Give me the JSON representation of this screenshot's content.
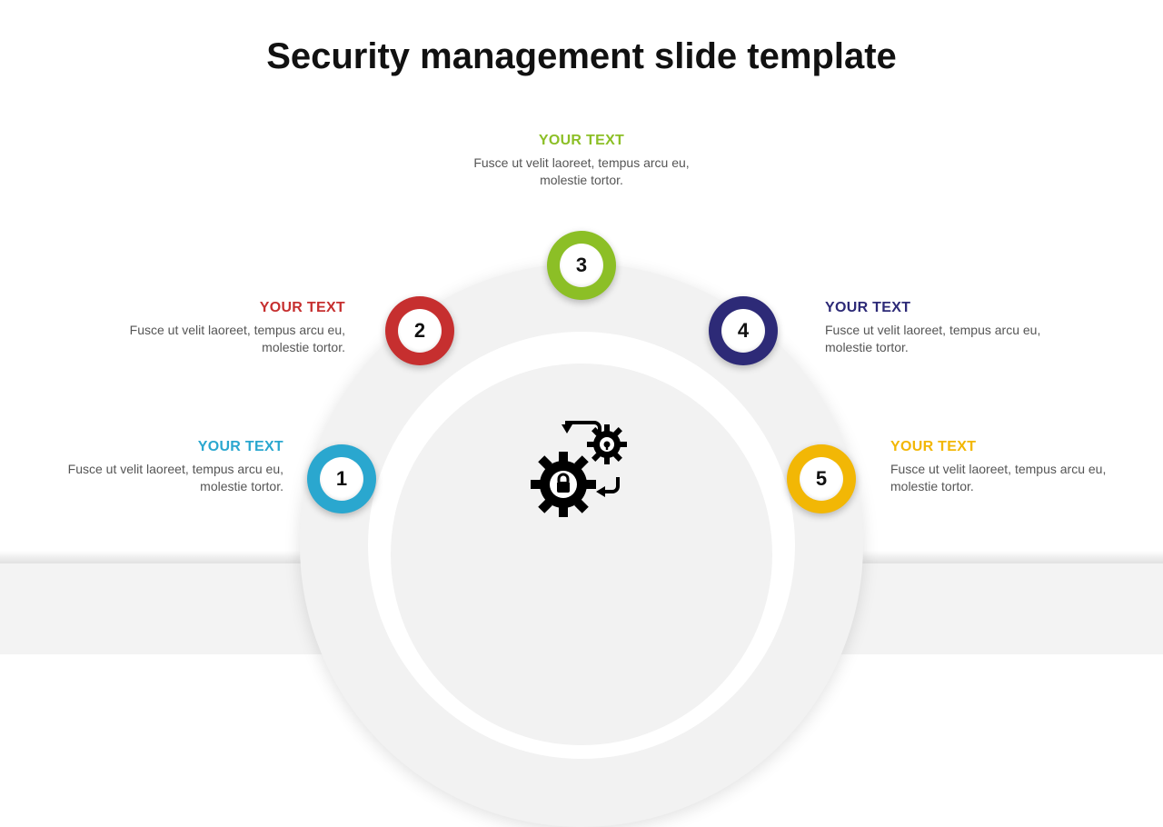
{
  "title": "Security management slide template",
  "nodes": [
    {
      "num": "1",
      "color": "#2aa7cf",
      "label": "YOUR TEXT",
      "body": "Fusce ut velit laoreet, tempus arcu eu, molestie tortor."
    },
    {
      "num": "2",
      "color": "#c62f2f",
      "label": "YOUR TEXT",
      "body": "Fusce ut velit laoreet, tempus arcu eu, molestie tortor."
    },
    {
      "num": "3",
      "color": "#8cbf26",
      "label": "YOUR TEXT",
      "body": "Fusce ut velit laoreet, tempus arcu eu, molestie tortor."
    },
    {
      "num": "4",
      "color": "#2d2a77",
      "label": "YOUR TEXT",
      "body": "Fusce ut velit laoreet, tempus arcu eu, molestie tortor."
    },
    {
      "num": "5",
      "color": "#f2b705",
      "label": "YOUR TEXT",
      "body": "Fusce ut velit laoreet, tempus arcu eu, molestie tortor."
    }
  ],
  "center_icon": "security-gears-lock-icon"
}
